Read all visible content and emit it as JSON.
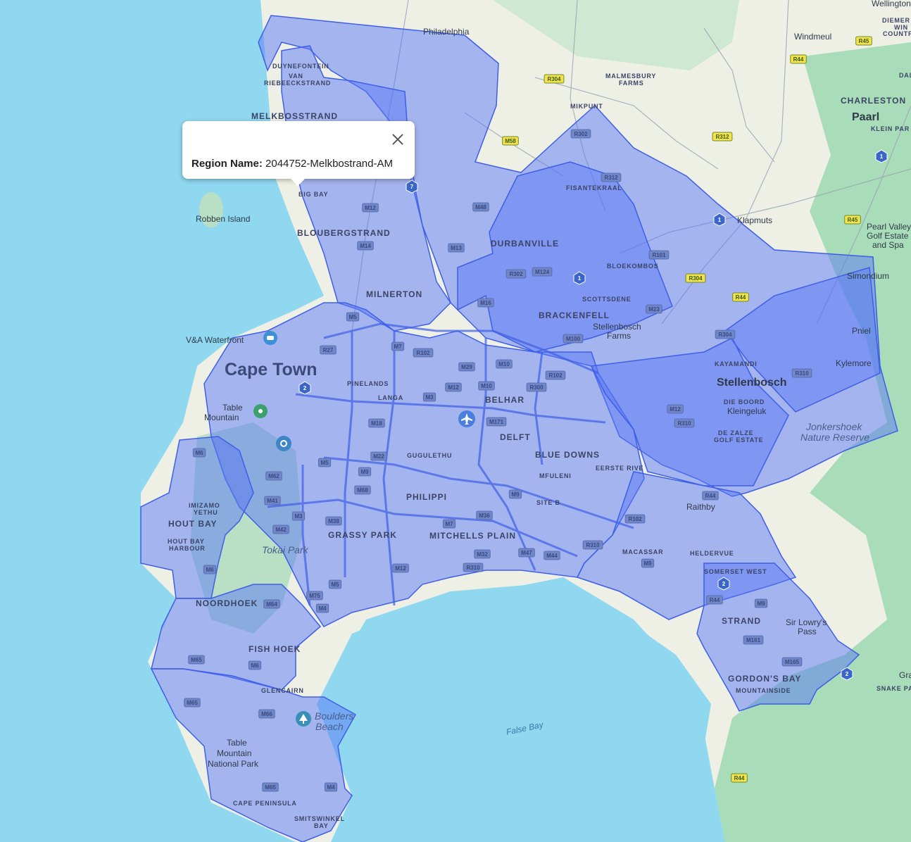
{
  "popup": {
    "key_label": "Region Name:",
    "value": "2044752-Melkbostrand-AM",
    "close_icon": "close-icon"
  },
  "colors": {
    "ocean": "#8fd8ef",
    "land": "#eef0e6",
    "green": "#a9dcb8",
    "region_fill": "#5a78f5",
    "region_stroke": "#3f5fe6"
  },
  "labels": {
    "wellington": "Wellington",
    "diemersfontein_1": "DIEMER",
    "diemersfontein_2": "WIN",
    "diemersfontein_3": "COUNTR",
    "windmeul": "Windmeul",
    "philadelphia": "Philadelphia",
    "malmesbury_1": "MALMESBURY",
    "malmesbury_2": "FARMS",
    "charleston": "CHARLESTON",
    "paarl": "Paarl",
    "klein_paarl": "KLEIN PAR",
    "dal": "DAL",
    "mikpunt": "MIKPUNT",
    "duynefontein": "DUYNEFONTEIN",
    "van_riebeeck_1": "VAN",
    "van_riebeeck_2": "RIEBEECKSTRAND",
    "melkbosstrand": "MELKBOSSTRAND",
    "fisantekraal": "FISANTEKRAAL",
    "big_bay": "BIG BAY",
    "robben_island": "Robben Island",
    "bloubergstrand": "BLOUBERGSTRAND",
    "durbanville": "DURBANVILLE",
    "klapmuts": "Klapmuts",
    "pearl_valley_1": "Pearl Valley",
    "pearl_valley_2": "Golf Estate",
    "pearl_valley_3": "and Spa",
    "bloekombos": "BLOEKOMBOS",
    "simondium": "Simondium",
    "milnerton": "MILNERTON",
    "scottsdene": "SCOTTSDENE",
    "brackenfell": "BRACKENFELL",
    "stellenbosch_farms_1": "Stellenbosch",
    "stellenbosch_farms_2": "Farms",
    "va_waterfront": "V&A Waterfront",
    "pniel": "Pniel",
    "kylemore": "Kylemore",
    "cape_town": "Cape Town",
    "kayamandi": "KAYAMANDI",
    "stellenbosch": "Stellenbosch",
    "pinelands": "PINELANDS",
    "langa": "LANGA",
    "belhar": "BELHAR",
    "die_boord": "DIE BOORD",
    "kleingeluk": "Kleingeluk",
    "table_mountain_1": "Table",
    "table_mountain_2": "Mountain",
    "delft": "DELFT",
    "de_zalze_1": "DE ZALZE",
    "de_zalze_2": "GOLF ESTATE",
    "jonkershoek_1": "Jonkershoek",
    "jonkershoek_2": "Nature Reserve",
    "gugulethu": "GUGULETHU",
    "blue_downs": "BLUE DOWNS",
    "eerste_river": "EERSTE RIVE",
    "mfuleni": "MFULENI",
    "philippi": "PHILIPPI",
    "site_b": "SITE B",
    "raithby": "Raithby",
    "imizamo_1": "IMIZAMO",
    "imizamo_2": "YETHU",
    "hout_bay": "HOUT BAY",
    "hout_bay_harbour_1": "HOUT BAY",
    "hout_bay_harbour_2": "HARBOUR",
    "grassy_park": "GRASSY PARK",
    "mitchells_plain": "MITCHELLS PLAIN",
    "tokai_park": "Tokai Park",
    "macassar": "MACASSAR",
    "heldervue": "HELDERVUE",
    "somerset_west": "SOMERSET WEST",
    "noordhoek": "NOORDHOEK",
    "strand": "STRAND",
    "sir_lowrys_1": "Sir Lowry's",
    "sir_lowrys_2": "Pass",
    "fish_hoek": "FISH HOEK",
    "gordons_bay": "GORDON'S BAY",
    "mountainside": "MOUNTAINSIDE",
    "gra": "Gra",
    "snake_pa": "SNAKE PA",
    "glencairn": "GLENCAIRN",
    "boulders_1": "Boulders",
    "boulders_2": "Beach",
    "false_bay": "False Bay",
    "tmnp_1": "Table",
    "tmnp_2": "Mountain",
    "tmnp_3": "National Park",
    "cape_peninsula": "CAPE PENINSULA",
    "smitswinkel_1": "SMITSWINKEL",
    "smitswinkel_2": "BAY"
  },
  "shields": {
    "r45_a": "R45",
    "r44_a": "R44",
    "r304_a": "R304",
    "r312_a": "R312",
    "m58": "M58",
    "r302": "R302",
    "r312_b": "R312",
    "m12_a": "M12",
    "m48": "M48",
    "m13": "M13",
    "m14": "M14",
    "r302_b": "R302",
    "m124": "M124",
    "r101": "R101",
    "r304_b": "R304",
    "r45_b": "R45",
    "r44_b": "R44",
    "m16": "M16",
    "m23": "M23",
    "m5_a": "M5",
    "m100": "M100",
    "r304_c": "R304",
    "r27": "R27",
    "m7": "M7",
    "r102_a": "R102",
    "m29": "M29",
    "m10_a": "M10",
    "r310_a": "R310",
    "m12_b": "M12",
    "m10_b": "M10",
    "r300": "R300",
    "r102_b": "R102",
    "m3_a": "M3",
    "m18": "M18",
    "m171": "M171",
    "m12_c": "M12",
    "r310_b": "R310",
    "m6_a": "M6",
    "m62": "M62",
    "m9_a": "M9",
    "m68": "M68",
    "m22": "M22",
    "m5_b": "M5",
    "m41": "M41",
    "m3_b": "M3",
    "m38": "M38",
    "m36": "M36",
    "m7_b": "M7",
    "m9_b": "M9",
    "r44_c": "R44",
    "m42": "M42",
    "r102_c": "R102",
    "m6_b": "M6",
    "m32": "M32",
    "m47": "M47",
    "m44": "M44",
    "m9_c": "M9",
    "r310_c": "R310",
    "m12_d": "M12",
    "r310_d": "R310",
    "m5_c": "M5",
    "m75": "M75",
    "m64": "M64",
    "m4_a": "M4",
    "r44_d": "R44",
    "m9_d": "M9",
    "m161": "M161",
    "m65_a": "M65",
    "m6_c": "M6",
    "m65_b": "M65",
    "m66": "M66",
    "m165": "M165",
    "m65_c": "M65",
    "m4_b": "M4",
    "r44_e": "R44"
  },
  "route_markers": {
    "n1_a": "1",
    "n1_b": "1",
    "n7": "7",
    "n1_c": "1",
    "n2_a": "2",
    "n2_b": "2",
    "n2_c": "2"
  },
  "poi": {
    "airport_icon": "airplane-icon",
    "ferry_icon": "ferry-icon",
    "park_icon": "tree-icon",
    "garden_icon": "flower-icon"
  }
}
